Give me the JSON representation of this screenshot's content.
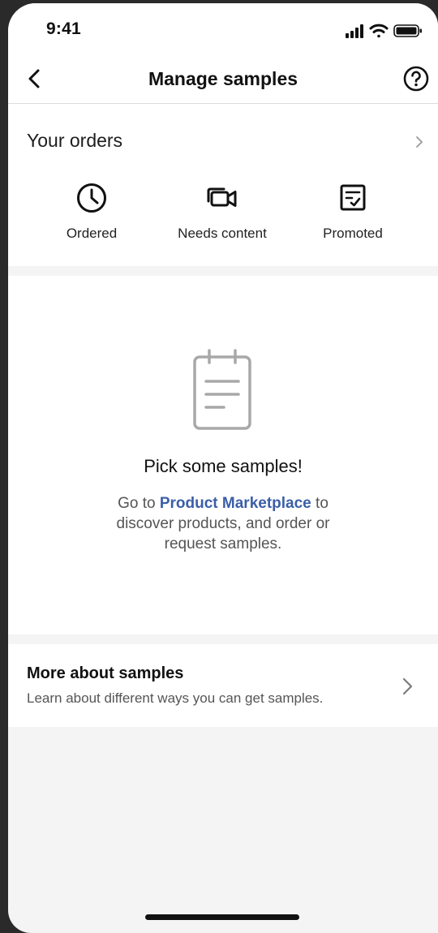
{
  "status_bar": {
    "time": "9:41"
  },
  "nav": {
    "title": "Manage samples"
  },
  "orders": {
    "title": "Your orders",
    "items": [
      {
        "label": "Ordered",
        "icon": "clock-icon"
      },
      {
        "label": "Needs content",
        "icon": "video-camera-icon"
      },
      {
        "label": "Promoted",
        "icon": "checked-document-icon"
      }
    ]
  },
  "empty_state": {
    "title": "Pick some samples!",
    "desc_prefix": "Go to ",
    "link_text": "Product Marketplace",
    "desc_line1_suffix": " to",
    "desc_rest": "discover products, and order or request samples."
  },
  "more": {
    "title": "More about samples",
    "subtitle": "Learn about different ways you can get samples."
  },
  "colors": {
    "link": "#3b5ea8",
    "background": "#f4f4f4",
    "surface": "#ffffff"
  }
}
